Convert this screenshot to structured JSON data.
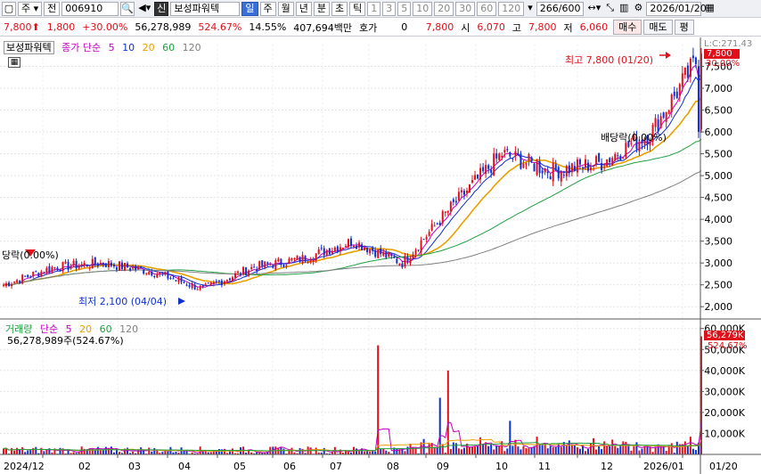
{
  "toolbar": {
    "items": [
      {
        "name": "window-icon",
        "label": "▢",
        "kind": "icon"
      },
      {
        "name": "market-select",
        "label": "주 ▾",
        "kind": "box"
      },
      {
        "name": "prev-button",
        "label": "전",
        "kind": "box"
      },
      {
        "name": "code-input",
        "label": "006910",
        "kind": "code"
      },
      {
        "name": "search-icon",
        "label": "🔍",
        "kind": "icon"
      },
      {
        "name": "sound-icon",
        "label": "◀▾",
        "kind": "flat"
      },
      {
        "name": "credit-badge",
        "label": "신",
        "kind": "dark"
      },
      {
        "name": "stock-name",
        "label": "보성파워텍",
        "kind": "name"
      },
      {
        "name": "period-day",
        "label": "일",
        "kind": "sel"
      },
      {
        "name": "period-week",
        "label": "주",
        "kind": "box"
      },
      {
        "name": "period-month",
        "label": "월",
        "kind": "box"
      },
      {
        "name": "period-year",
        "label": "년",
        "kind": "box"
      },
      {
        "name": "period-minute",
        "label": "분",
        "kind": "box"
      },
      {
        "name": "period-second",
        "label": "초",
        "kind": "box"
      },
      {
        "name": "period-tick",
        "label": "틱",
        "kind": "box"
      },
      {
        "name": "interval-1",
        "label": "1",
        "kind": "gray"
      },
      {
        "name": "interval-3",
        "label": "3",
        "kind": "gray"
      },
      {
        "name": "interval-5",
        "label": "5",
        "kind": "gray"
      },
      {
        "name": "interval-10",
        "label": "10",
        "kind": "gray"
      },
      {
        "name": "interval-20",
        "label": "20",
        "kind": "gray"
      },
      {
        "name": "interval-30",
        "label": "30",
        "kind": "gray"
      },
      {
        "name": "interval-60",
        "label": "60",
        "kind": "gray"
      },
      {
        "name": "interval-120",
        "label": "120",
        "kind": "gray"
      },
      {
        "name": "interval-dropdown",
        "label": "▾",
        "kind": "flat"
      },
      {
        "name": "count-input",
        "label": "266/600",
        "kind": "box"
      },
      {
        "name": "expand-icon",
        "label": "↔▾",
        "kind": "flat"
      },
      {
        "name": "zoom-icon",
        "label": "⤡",
        "kind": "flat"
      },
      {
        "name": "candle-type-icon",
        "label": "▥",
        "kind": "flat"
      },
      {
        "name": "settings-icon",
        "label": "⚙",
        "kind": "flat"
      },
      {
        "name": "date-input",
        "label": "2026/01/20",
        "kind": "date"
      },
      {
        "name": "calendar-icon",
        "label": "▦",
        "kind": "flat"
      }
    ]
  },
  "quote": {
    "price": "7,800",
    "up_arrow": "⬆",
    "change": "1,800",
    "change_pct": "+30.00%",
    "volume": "56,278,989",
    "volume_ratio": "524.67%",
    "turnover": "14.55%",
    "amount": "407,694백만",
    "hoga_label": "호가",
    "hoga_value": "0",
    "hoga_price": "7,800",
    "open_label": "시",
    "open": "6,070",
    "high_label": "고",
    "high": "7,800",
    "low_label": "저",
    "low": "6,060",
    "buy_button": "매수",
    "sell_button": "매도",
    "eval_button": "평"
  },
  "price_panel": {
    "name": "보성파워텍",
    "ma_label": "종가 단순",
    "ma_periods": [
      "5",
      "10",
      "20",
      "60",
      "120"
    ],
    "ma_colors": [
      "#c000c0",
      "#1030d0",
      "#e8a000",
      "#20a040",
      "#808080"
    ],
    "annotations": {
      "high": "최고 7,800 (01/20)",
      "low": "최저 2,100 (04/04)",
      "dividend_right": "배당락(0.00%)",
      "dividend_left": "당락(0.00%)"
    },
    "axis_tag_price": "7,800",
    "axis_tag_pct": "30.00%",
    "axis_top_note": "L:C:271.43"
  },
  "volume_panel": {
    "label": "거래량",
    "ma_label": "단순",
    "ma_periods": [
      "5",
      "20",
      "60",
      "120"
    ],
    "current": "56,278,989주(524.67%)",
    "axis_tag": "56,279K",
    "axis_tag_pct": "524.67%"
  },
  "colors": {
    "up": "#e0101a",
    "down": "#1030d0",
    "ma5": "#c000c0",
    "ma10": "#1030d0",
    "ma20": "#e8a000",
    "ma60": "#20a040",
    "ma120": "#808080"
  },
  "chart_data": [
    {
      "type": "candlestick",
      "title": "보성파워텍",
      "y_ticks": [
        "2,000",
        "2,500",
        "3,000",
        "3,500",
        "4,000",
        "4,500",
        "5,000",
        "5,500",
        "6,000",
        "6,500",
        "7,000",
        "7,500"
      ],
      "y_range": [
        1800,
        8000
      ],
      "x_ticks": [
        "2024/12",
        "02",
        "03",
        "04",
        "05",
        "06",
        "07",
        "08",
        "09",
        "10",
        "11",
        "12",
        "2026/01",
        "01/20"
      ],
      "close_trend": [
        {
          "month": "2024/12",
          "close": 2500
        },
        {
          "month": "01",
          "close": 2900
        },
        {
          "month": "02",
          "close": 3000
        },
        {
          "month": "03",
          "close": 2800
        },
        {
          "month": "04",
          "close": 2400
        },
        {
          "month": "05",
          "close": 2900
        },
        {
          "month": "06",
          "close": 3100
        },
        {
          "month": "07",
          "close": 3500
        },
        {
          "month": "08",
          "close": 3000
        },
        {
          "month": "09",
          "close": 4300
        },
        {
          "month": "10",
          "close": 5500
        },
        {
          "month": "11",
          "close": 5100
        },
        {
          "month": "12",
          "close": 5300
        },
        {
          "month": "2026/01",
          "close": 6000
        },
        {
          "month": "01/20",
          "close": 7800
        }
      ],
      "high": {
        "value": 7800,
        "date": "01/20"
      },
      "low": {
        "value": 2100,
        "date": "04/04"
      }
    },
    {
      "type": "bar",
      "title": "거래량",
      "y_ticks": [
        "10,000K",
        "20,000K",
        "30,000K",
        "40,000K",
        "50,000K",
        "60,000K"
      ],
      "y_range": [
        0,
        62000
      ],
      "last_value_k": 56279,
      "peak_values_k": [
        {
          "month": "08",
          "value": 52000
        },
        {
          "month": "09",
          "value": 27000
        },
        {
          "month": "09",
          "value": 40000
        },
        {
          "month": "10",
          "value": 16000
        },
        {
          "month": "01/20",
          "value": 56279
        }
      ]
    }
  ]
}
